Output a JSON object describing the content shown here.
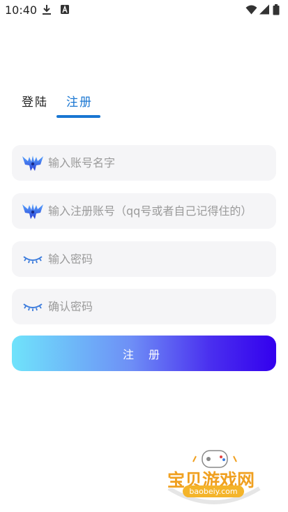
{
  "status_bar": {
    "time": "10:40"
  },
  "tabs": {
    "login_label": "登陆",
    "register_label": "注册",
    "active": "register"
  },
  "form": {
    "account_name": {
      "value": "",
      "placeholder": "输入账号名字",
      "icon": "wings-logo-icon"
    },
    "register_account": {
      "value": "",
      "placeholder": "输入注册账号（qq号或者自己记得住的）",
      "icon": "wings-logo-icon"
    },
    "password": {
      "value": "",
      "placeholder": "输入密码",
      "icon": "closed-eye-icon"
    },
    "confirm_password": {
      "value": "",
      "placeholder": "确认密码",
      "icon": "closed-eye-icon"
    },
    "submit_label": "注 册"
  },
  "watermark": {
    "brand": "宝贝游戏网",
    "url": "baobeiy.com"
  },
  "colors": {
    "accent": "#1976d2",
    "field_bg": "#f5f5f7",
    "button_gradient_start": "#6fe3fb",
    "button_gradient_end": "#3300ee"
  }
}
